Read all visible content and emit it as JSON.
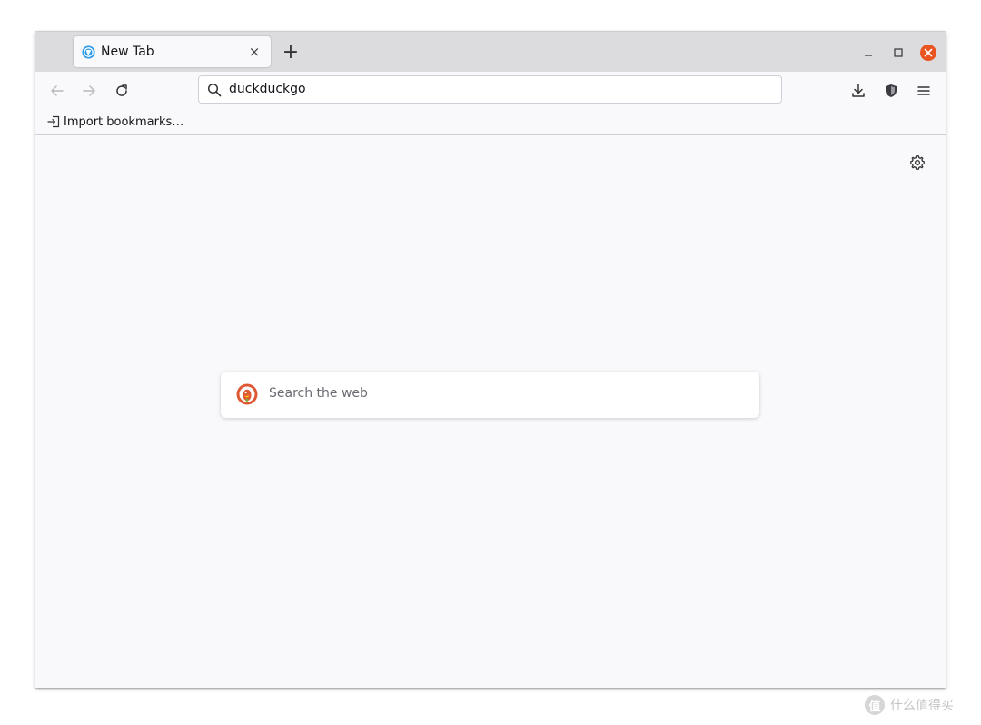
{
  "tab": {
    "title": "New Tab",
    "close_glyph": "×",
    "favicon": "firefox-globe-icon"
  },
  "toolbar": {
    "new_tab_glyph": "+"
  },
  "urlbar": {
    "value": "duckduckgo"
  },
  "bookmarks": {
    "import_label": "Import bookmarks…"
  },
  "newtab": {
    "search_placeholder": "Search the web",
    "engine_logo": "duckduckgo-logo"
  },
  "watermark": {
    "text": "什么值得买",
    "badge": "值"
  },
  "colors": {
    "close_button": "#e95420",
    "ddg_orange": "#de5833",
    "accent_blue": "#0a84ff"
  }
}
